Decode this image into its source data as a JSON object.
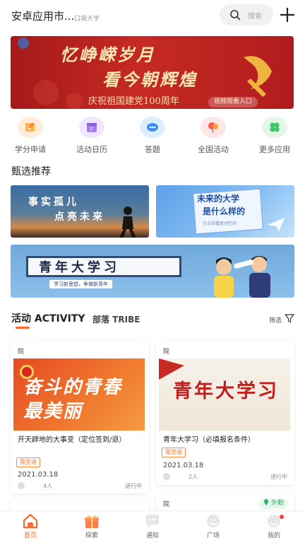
{
  "header": {
    "app_title": "安卓应用市...",
    "school": "口袋大学",
    "search_placeholder": "搜索"
  },
  "banner": {
    "line1": "忆峥嵘岁月",
    "line2": "看今朝辉煌",
    "line3": "庆祝祖国建党100周年",
    "tag": "视频观看入口"
  },
  "quick_actions": [
    {
      "label": "学分申请",
      "color": "#ffedd9"
    },
    {
      "label": "活动日历",
      "color": "#f0e6ff"
    },
    {
      "label": "答题",
      "color": "#dfeeff"
    },
    {
      "label": "全国活动",
      "color": "#ffe6e6"
    },
    {
      "label": "更多应用",
      "color": "#e2f7e4"
    }
  ],
  "section_title": "甄选推荐",
  "recommendations": {
    "rec1_line1": "事实孤儿",
    "rec1_line2": "点亮未来",
    "rec2_line1": "未来的大学",
    "rec2_line2": "是什么样的",
    "rec2_line3": "已点击看取词空间",
    "rec3_line1": "青年大学习",
    "rec3_line2": "学习新思想，争做新青年"
  },
  "tabs": {
    "active": "活动 ACTIVITY",
    "other": "部落 TRIBE",
    "filter": "筛选"
  },
  "cards": [
    {
      "org": "院",
      "image_text": "奋斗的青春最美丽",
      "title": "开天辟地的大事变（定位签到/退）",
      "badge": "需签退",
      "date": "2021.03.18",
      "count": "4人",
      "status": "进行中"
    },
    {
      "org": "院",
      "image_text": "青年大学习",
      "title": "青年大学习（必填报名条件）",
      "badge": "需签退",
      "date": "2021.03.18",
      "count": "2人",
      "status": "进行中"
    },
    {
      "org": "院",
      "out_badge": "外勤"
    }
  ],
  "bottom_nav": [
    {
      "label": "首页"
    },
    {
      "label": "探索"
    },
    {
      "label": "通知"
    },
    {
      "label": "广场"
    },
    {
      "label": "我的"
    }
  ],
  "colors": {
    "accent": "#ff6a2b",
    "banner_red": "#b01c1e",
    "out_green": "#2fb36a"
  }
}
